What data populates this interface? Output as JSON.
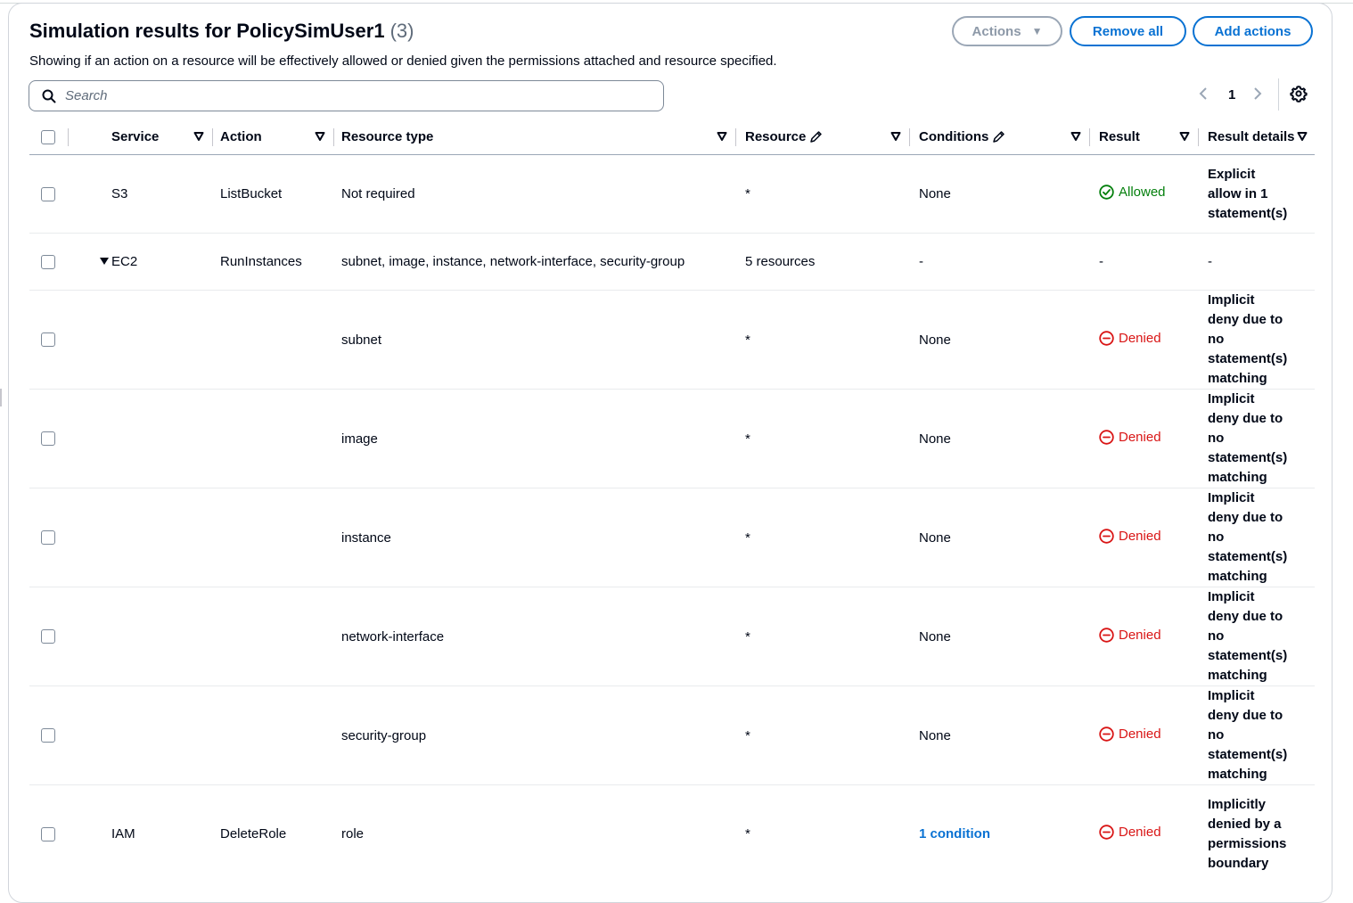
{
  "header": {
    "title": "Simulation results for PolicySimUser1",
    "count": "(3)",
    "description": "Showing if an action on a resource will be effectively allowed or denied given the permissions attached and resource specified."
  },
  "buttons": {
    "actions": "Actions",
    "remove_all": "Remove all",
    "add_actions": "Add actions"
  },
  "search": {
    "placeholder": "Search"
  },
  "pagination": {
    "current_page": "1"
  },
  "columns": {
    "service": "Service",
    "action": "Action",
    "resource_type": "Resource type",
    "resource": "Resource",
    "conditions": "Conditions",
    "result": "Result",
    "result_details": "Result details"
  },
  "rows": [
    {
      "service": "S3",
      "action": "ListBucket",
      "resource_type": "Not required",
      "resource": "*",
      "conditions": "None",
      "result": "Allowed",
      "details": "Explicit allow in 1 statement(s)"
    },
    {
      "service": "EC2",
      "action": "RunInstances",
      "resource_type": "subnet, image, instance, network-interface, security-group",
      "resource": "5 resources",
      "conditions": "-",
      "result": "-",
      "details": "-"
    },
    {
      "service": "",
      "action": "",
      "resource_type": "subnet",
      "resource": "*",
      "conditions": "None",
      "result": "Denied",
      "details": "Implicit deny due to no statement(s) matching"
    },
    {
      "service": "",
      "action": "",
      "resource_type": "image",
      "resource": "*",
      "conditions": "None",
      "result": "Denied",
      "details": "Implicit deny due to no statement(s) matching"
    },
    {
      "service": "",
      "action": "",
      "resource_type": "instance",
      "resource": "*",
      "conditions": "None",
      "result": "Denied",
      "details": "Implicit deny due to no statement(s) matching"
    },
    {
      "service": "",
      "action": "",
      "resource_type": "network-interface",
      "resource": "*",
      "conditions": "None",
      "result": "Denied",
      "details": "Implicit deny due to no statement(s) matching"
    },
    {
      "service": "",
      "action": "",
      "resource_type": "security-group",
      "resource": "*",
      "conditions": "None",
      "result": "Denied",
      "details": "Implicit deny due to no statement(s) matching"
    },
    {
      "service": "IAM",
      "action": "DeleteRole",
      "resource_type": "role",
      "resource": "*",
      "conditions": "1 condition",
      "result": "Denied",
      "details": "Implicitly denied by a permissions boundary"
    }
  ],
  "colors": {
    "link": "#0972d3",
    "allowed": "#037f0c",
    "denied": "#d91515",
    "text": "#000716"
  },
  "icons": {
    "search": "search-icon",
    "settings": "gear-icon",
    "allowed": "check-circle-icon",
    "denied": "minus-circle-icon",
    "edit": "pencil-icon"
  }
}
